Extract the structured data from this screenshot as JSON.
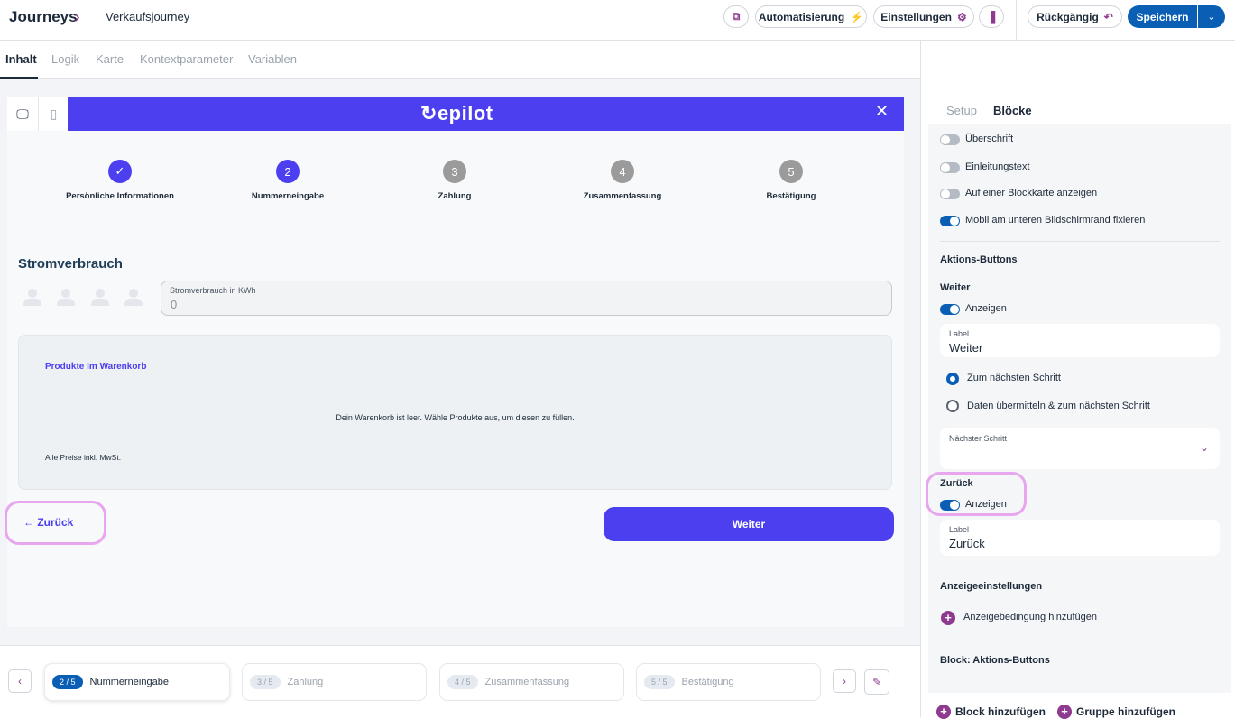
{
  "header": {
    "breadcrumb_root": "Journeys",
    "breadcrumb_page": "Verkaufsjourney",
    "automation_label": "Automatisierung",
    "settings_label": "Einstellungen",
    "undo_label": "Rückgängig",
    "save_label": "Speichern"
  },
  "tabs": [
    "Inhalt",
    "Logik",
    "Karte",
    "Kontextparameter",
    "Variablen"
  ],
  "preview": {
    "logo": "epilot",
    "steps": [
      {
        "num": "",
        "label": "Persönliche Informationen",
        "state": "done"
      },
      {
        "num": "2",
        "label": "Nummerneingabe",
        "state": "active"
      },
      {
        "num": "3",
        "label": "Zahlung",
        "state": "pending"
      },
      {
        "num": "4",
        "label": "Zusammenfassung",
        "state": "pending"
      },
      {
        "num": "5",
        "label": "Bestätigung",
        "state": "pending"
      }
    ],
    "section_title": "Stromverbrauch",
    "consumption_field_label": "Stromverbrauch in KWh",
    "consumption_field_value": "0",
    "cart_title": "Produkte im Warenkorb",
    "cart_empty": "Dein Warenkorb ist leer. Wähle Produkte aus, um diesen zu füllen.",
    "cart_note": "Alle Preise inkl. MwSt.",
    "back_label": "Zurück",
    "next_label": "Weiter"
  },
  "stepnav": [
    {
      "badge": "2 / 5",
      "name": "Nummerneingabe",
      "active": true
    },
    {
      "badge": "3 / 5",
      "name": "Zahlung",
      "active": false
    },
    {
      "badge": "4 / 5",
      "name": "Zusammenfassung",
      "active": false
    },
    {
      "badge": "5 / 5",
      "name": "Bestätigung",
      "active": false
    }
  ],
  "panel": {
    "tabs": {
      "setup": "Setup",
      "blocks": "Blöcke"
    },
    "toggles": [
      {
        "label": "Überschrift",
        "on": false
      },
      {
        "label": "Einleitungstext",
        "on": false
      },
      {
        "label": "Auf einer Blockkarte anzeigen",
        "on": false
      },
      {
        "label": "Mobil am unteren Bildschirmrand fixieren",
        "on": true
      }
    ],
    "action_buttons_heading": "Aktions-Buttons",
    "next_heading": "Weiter",
    "next_show_label": "Anzeigen",
    "next_field_label": "Label",
    "next_field_value": "Weiter",
    "radio_next": "Zum nächsten Schritt",
    "radio_submit": "Daten übermitteln & zum nächsten Schritt",
    "next_step_label": "Nächster Schritt",
    "back_heading": "Zurück",
    "back_show_label": "Anzeigen",
    "back_field_label": "Label",
    "back_field_value": "Zurück",
    "display_heading": "Anzeigeeinstellungen",
    "add_condition": "Anzeigebedingung hinzufügen",
    "block_heading": "Block: Aktions-Buttons",
    "add_block": "Block hinzufügen",
    "add_group": "Gruppe hinzufügen"
  },
  "colors": {
    "primary": "#0a5fb4",
    "brand": "#4b3ff0",
    "accent": "#8e3a8f",
    "highlight": "#e8a6ef"
  }
}
